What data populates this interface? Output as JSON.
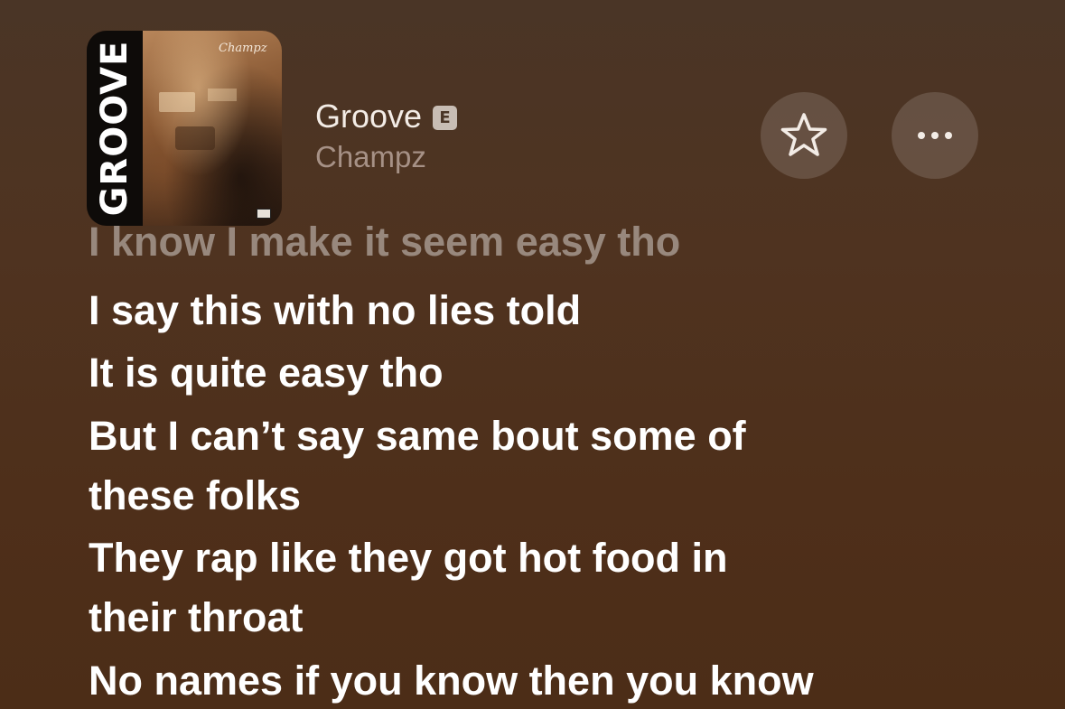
{
  "track": {
    "title": "Groove",
    "explicit_label": "E",
    "artist": "Champz",
    "artwork": {
      "spine_text": "GROOVE",
      "signature_text": "Champz"
    }
  },
  "actions": {
    "favorite_icon": "star-icon",
    "more_icon": "ellipsis-icon"
  },
  "lyrics": {
    "past_line": "I know I make it seem easy tho",
    "lines": [
      "I say this with no lies told",
      "It is quite easy tho",
      "But I can’t say same bout some of",
      "these folks",
      "They rap like they got hot food in",
      "their throat",
      "No names if you know then you know"
    ]
  },
  "colors": {
    "background_top": "#4a3526",
    "background_bottom": "#4c2d17",
    "lyric_active": "#ffffff",
    "lyric_past": "rgba(255,255,255,0.42)",
    "artist_text": "#a69186"
  }
}
